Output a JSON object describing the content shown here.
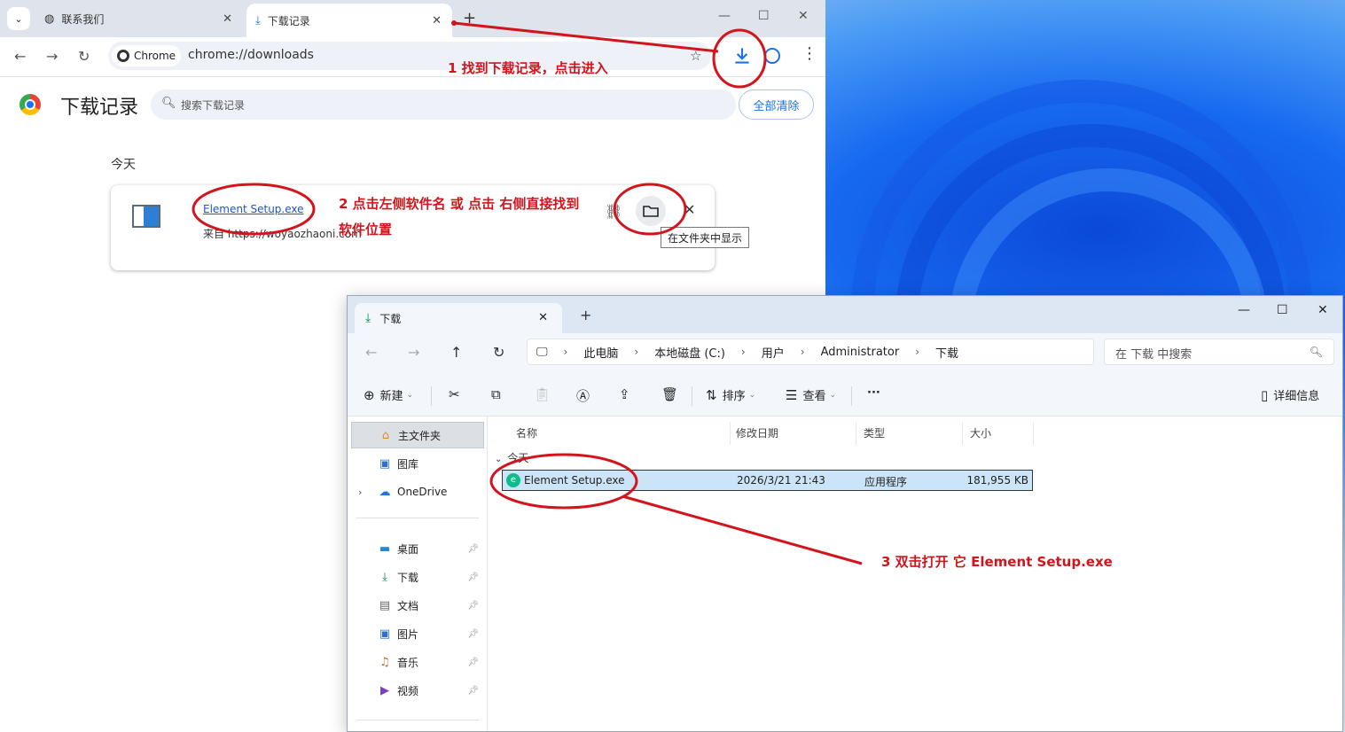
{
  "chrome": {
    "tabs": [
      {
        "label": "联系我们",
        "active": false
      },
      {
        "label": "下载记录",
        "active": true
      }
    ],
    "omnibox": {
      "chip": "Chrome",
      "url": "chrome://downloads"
    },
    "page": {
      "title": "下载记录",
      "search_placeholder": "搜索下载记录",
      "clear_all": "全部清除",
      "group": "今天",
      "item": {
        "filename": "Element Setup.exe",
        "source": "来自 https://woyaozhaoni.com"
      },
      "tooltip": "在文件夹中显示"
    }
  },
  "explorer": {
    "tab": "下载",
    "breadcrumb": [
      "此电脑",
      "本地磁盘 (C:)",
      "用户",
      "Administrator",
      "下载"
    ],
    "search_placeholder": "在 下载 中搜索",
    "commands": {
      "new": "新建",
      "sort": "排序",
      "view": "查看",
      "more": "···",
      "details": "详细信息"
    },
    "nav": {
      "home": "主文件夹",
      "gallery": "图库",
      "onedrive": "OneDrive",
      "desktop": "桌面",
      "downloads": "下载",
      "documents": "文档",
      "pictures": "图片",
      "music": "音乐",
      "videos": "视频"
    },
    "columns": [
      "名称",
      "修改日期",
      "类型",
      "大小"
    ],
    "group": "今天",
    "file": {
      "name": "Element Setup.exe",
      "modified": "2026/3/21 21:43",
      "type": "应用程序",
      "size": "181,955 KB"
    }
  },
  "annotations": {
    "step1": "1  找到下载记录，点击进入",
    "step2_line1": "2 点击左侧软件名 或 点击 右侧直接找到",
    "step2_line2": "软件位置",
    "step3": "3 双击打开 它 Element Setup.exe"
  },
  "colors": {
    "annotation": "#d4141c",
    "link": "#1a55c9",
    "chrome_accent": "#1a73e8",
    "selection": "#cce4f7"
  }
}
